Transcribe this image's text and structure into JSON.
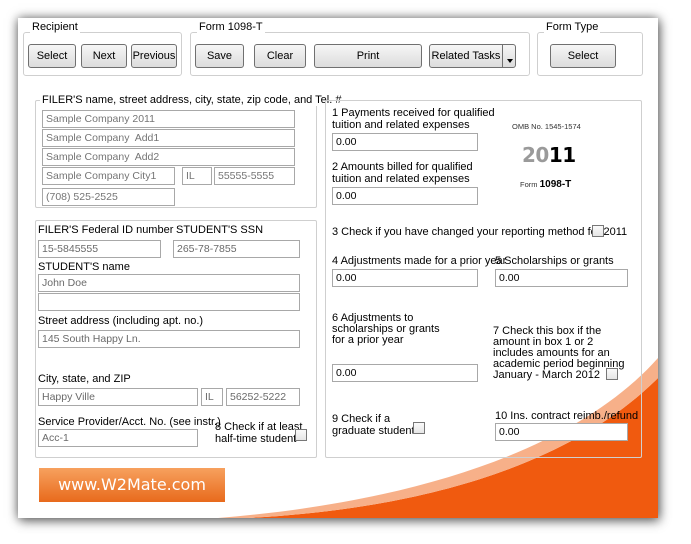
{
  "groups": {
    "recipient": "Recipient",
    "form": "Form 1098-T",
    "form_type": "Form Type"
  },
  "buttons": {
    "select": "Select",
    "next": "Next",
    "previous": "Previous",
    "save": "Save",
    "clear": "Clear",
    "print": "Print",
    "related_tasks": "Related Tasks",
    "form_type_select": "Select"
  },
  "filer": {
    "header": "FILER'S name, street address, city, state, zip code, and Tel. #",
    "name_placeholder": "Sample Company 2011",
    "address1_placeholder": "Sample Company  Add1",
    "address2_placeholder": "Sample Company  Add2",
    "city_placeholder": "Sample Company City1",
    "state_placeholder": "IL",
    "zip_placeholder": "55555-5555",
    "phone_placeholder": "(708) 525-2525",
    "federal_id_label": "FILER'S Federal ID number",
    "federal_id_value": "15-5845555"
  },
  "student": {
    "ssn_label": "STUDENT'S SSN",
    "ssn_value": "265-78-7855",
    "name_label": "STUDENT'S name",
    "name_value": "John Doe",
    "name2_value": "",
    "street_label": "Street address (including apt. no.)",
    "street_value": "145 South Happy Ln.",
    "csz_label": "City, state, and ZIP",
    "city_value": "Happy Ville",
    "state_value": "IL",
    "zip_value": "56252-5222",
    "account_label": "Service Provider/Acct. No. (see instr.)",
    "account_value": "Acc-1",
    "box8_line1": "8 Check if at least",
    "box8_line2": "half-time student"
  },
  "boxes": {
    "box1_line1": "1 Payments received for qualified",
    "box1_line2": "tuition and related expenses",
    "box1_value": "0.00",
    "box2_line1": "2 Amounts billed for qualified",
    "box2_line2": "tuition and related expenses",
    "box2_value": "0.00",
    "omb": "OMB No. 1545-1574",
    "year_prefix": "20",
    "year_suffix": "11",
    "form_prefix": "Form ",
    "form_name": "1098-T",
    "box3_label": "3 Check if you have changed your reporting method for 2011",
    "box4_label": "4 Adjustments made for a prior year",
    "box4_value": "0.00",
    "box5_label": "5 Scholarships or grants",
    "box5_value": "0.00",
    "box6_line1": "6 Adjustments to",
    "box6_line2": "scholarships or grants",
    "box6_line3": "for a prior year",
    "box6_value": "0.00",
    "box7_line1": "7 Check this box if the",
    "box7_line2": "amount in box 1 or 2",
    "box7_line3": "includes amounts for an",
    "box7_line4": "academic period beginning",
    "box7_line5": "January - March 2012",
    "box9_line1": "9 Check if a",
    "box9_line2": "graduate student",
    "box10_label": "10 Ins. contract reimb./refund",
    "box10_value": "0.00"
  },
  "banner": "www.W2Mate.com",
  "colors": {
    "banner_orange": "#e86a1c",
    "swoosh_orange": "#f05a0f"
  }
}
